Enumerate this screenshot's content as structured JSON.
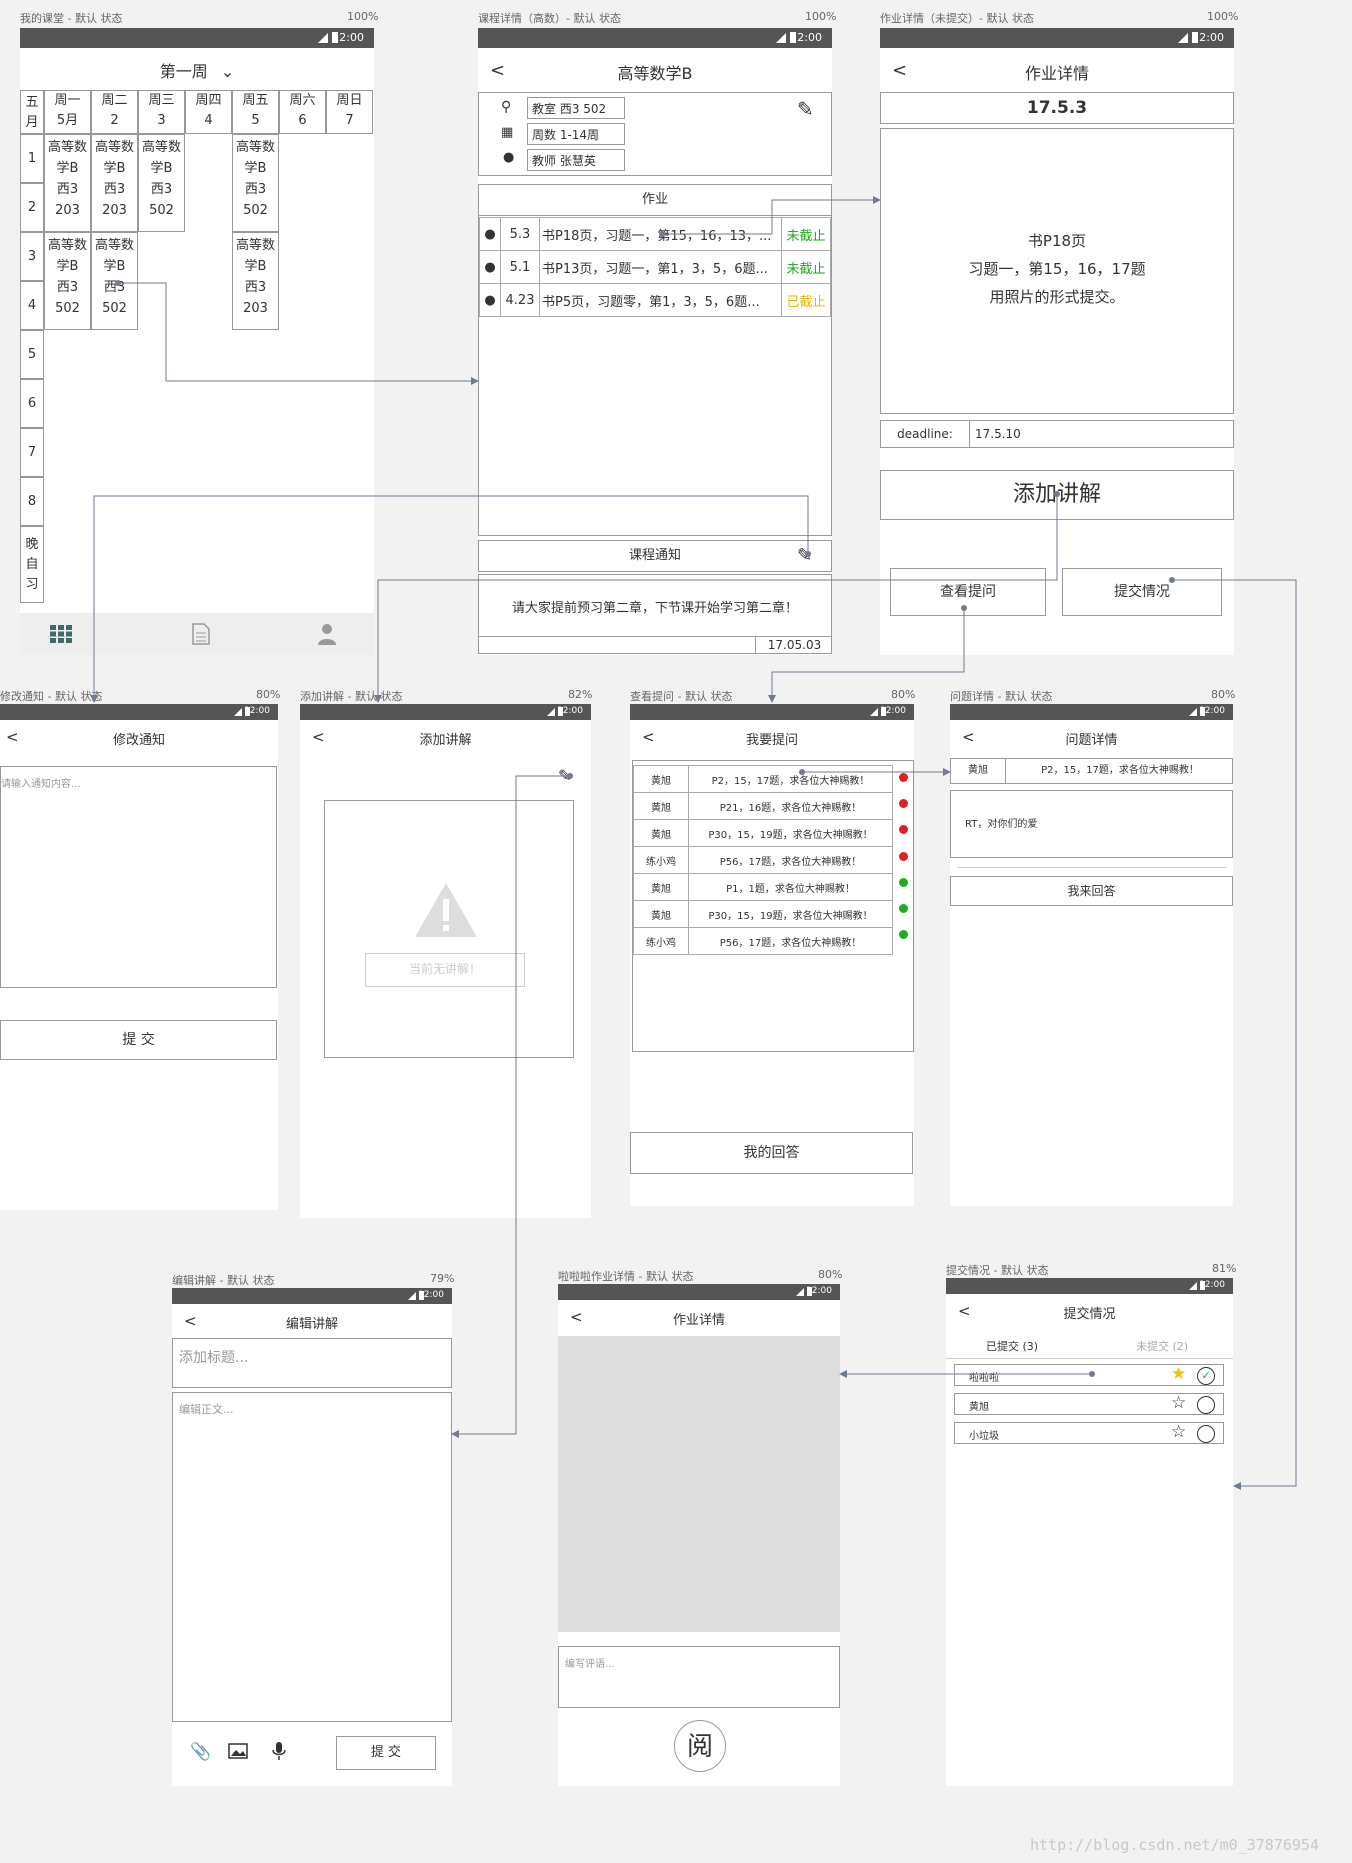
{
  "status_time": "12:00",
  "watermark": "http://blog.csdn.net/m0_37876954",
  "timetable": {
    "caption": "我的课堂 - 默认 状态",
    "percent": "100%",
    "week_title": "第一周",
    "month_header": "五\n月",
    "days": [
      {
        "name": "周一",
        "date": "5月"
      },
      {
        "name": "周二",
        "date": "2"
      },
      {
        "name": "周三",
        "date": "3"
      },
      {
        "name": "周四",
        "date": "4"
      },
      {
        "name": "周五",
        "date": "5"
      },
      {
        "name": "周六",
        "date": "6"
      },
      {
        "name": "周日",
        "date": "7"
      }
    ],
    "periods": [
      "1",
      "2",
      "3",
      "4",
      "5",
      "6",
      "7",
      "8",
      "晚\n自\n习"
    ],
    "classes": [
      {
        "text": "高等数\n学B\n西3\n203"
      },
      {
        "text": "高等数\n学B\n西3\n203"
      },
      {
        "text": "高等数\n学B\n西3\n502"
      },
      {
        "text": "高等数\n学B\n西3\n502"
      },
      {
        "text": "高等数\n学B\n西3\n502"
      },
      {
        "text": "高等数\n学B\n西3\n502"
      },
      {
        "text": "高等数\n学B\n西3\n203"
      }
    ]
  },
  "course": {
    "caption": "课程详情（高数）- 默认 状态",
    "percent": "100%",
    "title": "高等数学B",
    "room": "教室 西3 502",
    "weeks": "周数 1-14周",
    "teacher": "教师 张慧英",
    "homework_header": "作业",
    "homework": [
      {
        "date": "5.3",
        "text": "书P18页，习题一，第15，16，13，...",
        "status": "未截止",
        "color": "#22aa22"
      },
      {
        "date": "5.1",
        "text": "书P13页，习题一，第1，3，5，6题...",
        "status": "未截止",
        "color": "#22aa22"
      },
      {
        "date": "4.23",
        "text": "书P5页，习题零，第1，3，5，6题...",
        "status": "已截止",
        "color": "#e6b800"
      }
    ],
    "notice_header": "课程通知",
    "notice_text": "请大家提前预习第二章，下节课开始学习第二章！",
    "notice_date": "17.05.03"
  },
  "hwdetail": {
    "caption": "作业详情（未提交）- 默认 状态",
    "percent": "100%",
    "title": "作业详情",
    "date": "17.5.3",
    "body": [
      "书P18页",
      "习题一，第15，16，17题",
      "用照片的形式提交。"
    ],
    "deadline_label": "deadline:",
    "deadline_value": "17.5.10",
    "add_button": "添加讲解",
    "questions_button": "查看提问",
    "submissions_button": "提交情况"
  },
  "editnotice": {
    "caption": "修改通知 - 默认 状态",
    "percent": "80%",
    "title": "修改通知",
    "placeholder": "请输入通知内容...",
    "submit": "提 交"
  },
  "addexpl": {
    "caption": "添加讲解 - 默认 状态",
    "percent": "82%",
    "title": "添加讲解",
    "empty": "当前无讲解！"
  },
  "questions": {
    "caption": "查看提问 - 默认 状态",
    "percent": "80%",
    "title": "我要提问",
    "rows": [
      {
        "name": "黄旭",
        "text": "P2，15，17题，求各位大神赐教！",
        "color": "#e02020"
      },
      {
        "name": "黄旭",
        "text": "P21，16题，求各位大神赐教！",
        "color": "#e02020"
      },
      {
        "name": "黄旭",
        "text": "P30，15，19题，求各位大神赐教！",
        "color": "#e02020"
      },
      {
        "name": "练小鸡",
        "text": "P56，17题，求各位大神赐教！",
        "color": "#e02020"
      },
      {
        "name": "黄旭",
        "text": "P1，1题，求各位大神赐教！",
        "color": "#22aa22"
      },
      {
        "name": "黄旭",
        "text": "P30，15，19题，求各位大神赐教！",
        "color": "#22aa22"
      },
      {
        "name": "练小鸡",
        "text": "P56，17题，求各位大神赐教！",
        "color": "#22aa22"
      }
    ],
    "my_answer": "我的回答"
  },
  "qdetail": {
    "caption": "问题详情 - 默认 状态",
    "percent": "80%",
    "title": "问题详情",
    "name": "黄旭",
    "question": "P2，15，17题，求各位大神赐教！",
    "body": "RT，对你们的爱",
    "answer_button": "我来回答"
  },
  "editexpl": {
    "caption": "编辑讲解 - 默认 状态",
    "percent": "79%",
    "title": "编辑讲解",
    "title_placeholder": "添加标题...",
    "body_placeholder": "编辑正文...",
    "submit": "提 交"
  },
  "hwview": {
    "caption": "啦啦啦作业详情 - 默认 状态",
    "percent": "80%",
    "title": "作业详情",
    "comment_placeholder": "编写评语...",
    "read_button": "阅"
  },
  "submissions": {
    "caption": "提交情况 - 默认 状态",
    "percent": "81%",
    "title": "提交情况",
    "tab_submitted": "已提交 (3)",
    "tab_unsubmitted": "未提交 (2)",
    "students": [
      {
        "name": "啦啦啦",
        "star": "★",
        "star_color": "#f5c400",
        "check": "✓"
      },
      {
        "name": "黄旭",
        "star": "☆",
        "star_color": "#333",
        "check": ""
      },
      {
        "name": "小垃圾",
        "star": "☆",
        "star_color": "#333",
        "check": ""
      }
    ]
  }
}
